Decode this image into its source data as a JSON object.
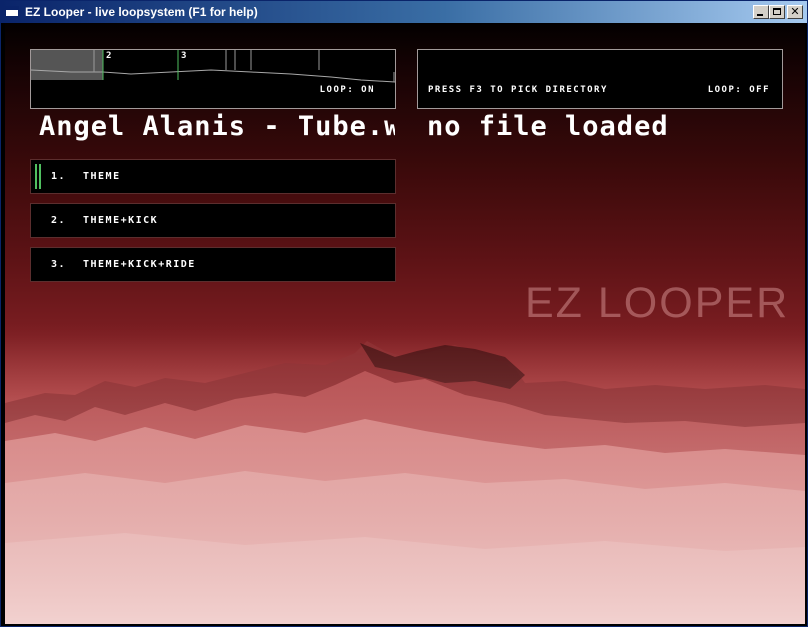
{
  "window": {
    "title": "EZ Looper - live loopsystem (F1 for help)",
    "icon": "app-window-icon",
    "controls": {
      "minimize": "minimize-icon",
      "maximize": "maximize-icon",
      "close_glyph": "✕"
    }
  },
  "left_deck": {
    "markers": [
      "2",
      "3"
    ],
    "loop_status": "LOOP: ON",
    "track_title": "Angel Alanis - Tube.wa"
  },
  "right_deck": {
    "hint": "PRESS F3 TO PICK DIRECTORY",
    "loop_status": "LOOP: OFF",
    "track_title": "no file loaded"
  },
  "loops": [
    {
      "number": "1.",
      "name": "THEME",
      "active": true
    },
    {
      "number": "2.",
      "name": "THEME+KICK",
      "active": false
    },
    {
      "number": "3.",
      "name": "THEME+KICK+RIDE",
      "active": false
    }
  ],
  "brand": "EZ LOOPER",
  "colors": {
    "accent": "#50c060",
    "titlebar": "#0a246a",
    "background": "#5f1316"
  }
}
